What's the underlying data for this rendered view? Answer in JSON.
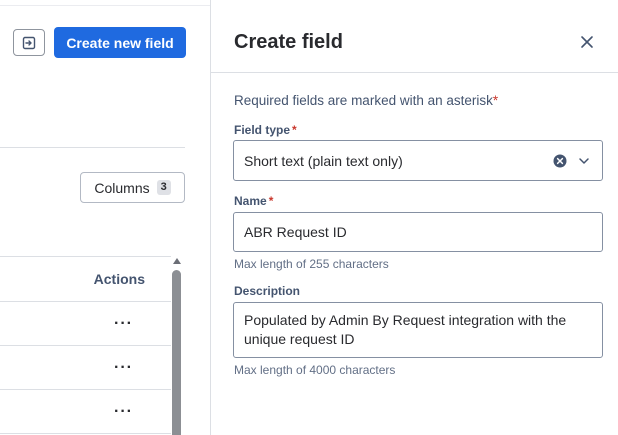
{
  "background_page": {
    "create_field_button": "Create new field",
    "columns_button": {
      "label": "Columns",
      "count": "3"
    },
    "table": {
      "actions_header": "Actions",
      "row_actions": [
        "···",
        "···",
        "···"
      ]
    }
  },
  "panel": {
    "title": "Create field",
    "required_note": "Required fields are marked with an asterisk",
    "asterisk": "*",
    "field_type": {
      "label": "Field type",
      "value": "Short text (plain text only)"
    },
    "name": {
      "label": "Name",
      "value": "ABR Request ID",
      "helper": "Max length of 255 characters"
    },
    "description": {
      "label": "Description",
      "value": "Populated by Admin By Request integration with the unique request ID",
      "helper": "Max length of 4000 characters"
    }
  },
  "icons": {
    "toggle_panel": "panel-toggle-icon",
    "close": "close-icon",
    "clear": "clear-icon",
    "chevron": "chevron-down-icon"
  },
  "colors": {
    "primary": "#1f6ae0",
    "required": "#c9372c",
    "border": "#dcdfe4"
  }
}
